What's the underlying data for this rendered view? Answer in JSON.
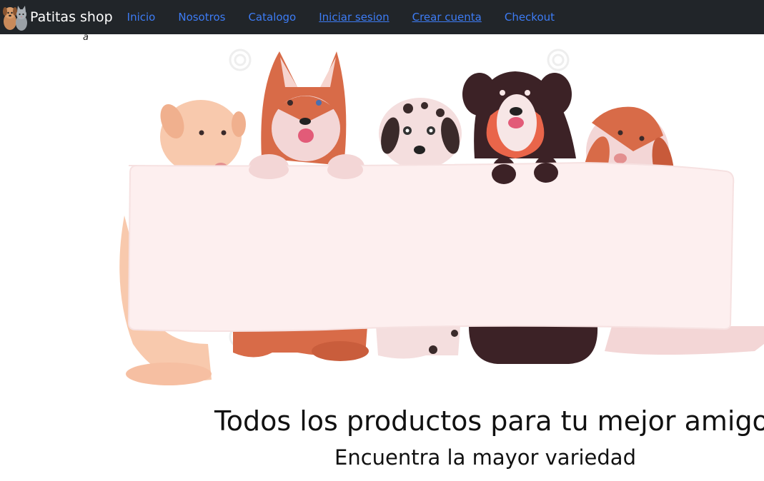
{
  "navbar": {
    "brand_name": "Patitas shop",
    "logo_icon": "dog-and-cat-logo-icon",
    "links": [
      {
        "label": "Inicio"
      },
      {
        "label": "Nosotros"
      },
      {
        "label": "Catalogo"
      },
      {
        "label": "Iniciar sesion"
      },
      {
        "label": "Crear cuenta"
      },
      {
        "label": "Checkout"
      }
    ],
    "colors": {
      "background": "#212529",
      "link": "#3d7cf5",
      "brand": "#ffffff"
    }
  },
  "stray_text": "a",
  "hero": {
    "image": "dogs-holding-blank-banner-illustration"
  },
  "main": {
    "title": "Todos los productos para tu mejor amigo",
    "subtitle": "Encuentra la mayor variedad"
  }
}
